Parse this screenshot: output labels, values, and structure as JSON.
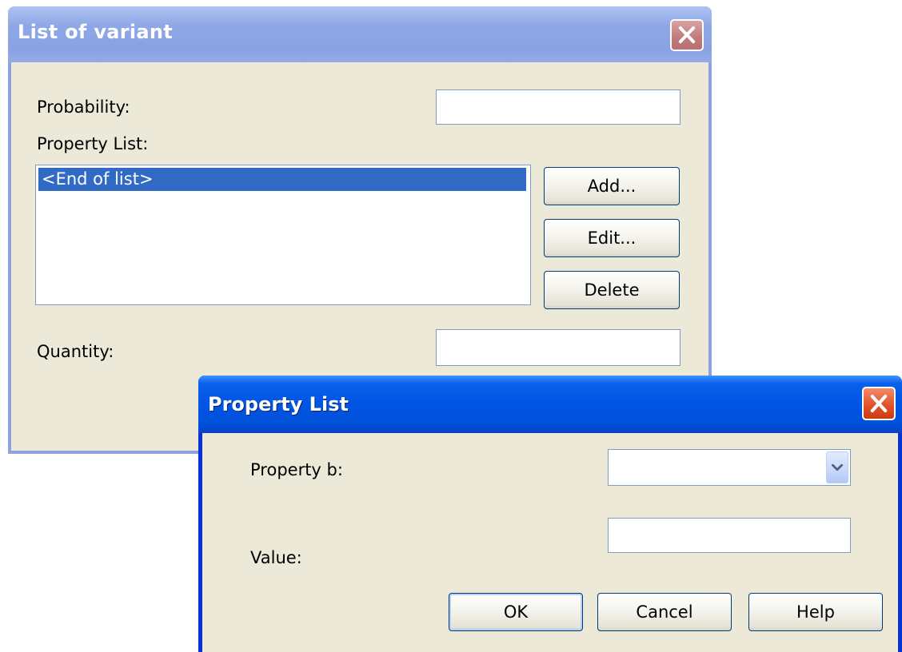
{
  "list_dialog": {
    "title": "List of variant",
    "probability_label": "Probability:",
    "probability_value": "",
    "property_list_label": "Property List:",
    "list_items": [
      "<End of list>"
    ],
    "add_label": "Add...",
    "edit_label": "Edit...",
    "delete_label": "Delete",
    "quantity_label": "Quantity:",
    "quantity_value": ""
  },
  "property_dialog": {
    "title": "Property List",
    "property_label": "Property b:",
    "property_value": "",
    "value_label": "Value:",
    "value_value": "",
    "ok_label": "OK",
    "cancel_label": "Cancel",
    "help_label": "Help"
  },
  "colors": {
    "inactive_title": "#8EA7E6",
    "active_title": "#0055E5",
    "dialog_bg": "#ECE9D8",
    "selection": "#316AC5"
  },
  "icons": {
    "close": "close-icon",
    "dropdown": "chevron-down-icon"
  }
}
